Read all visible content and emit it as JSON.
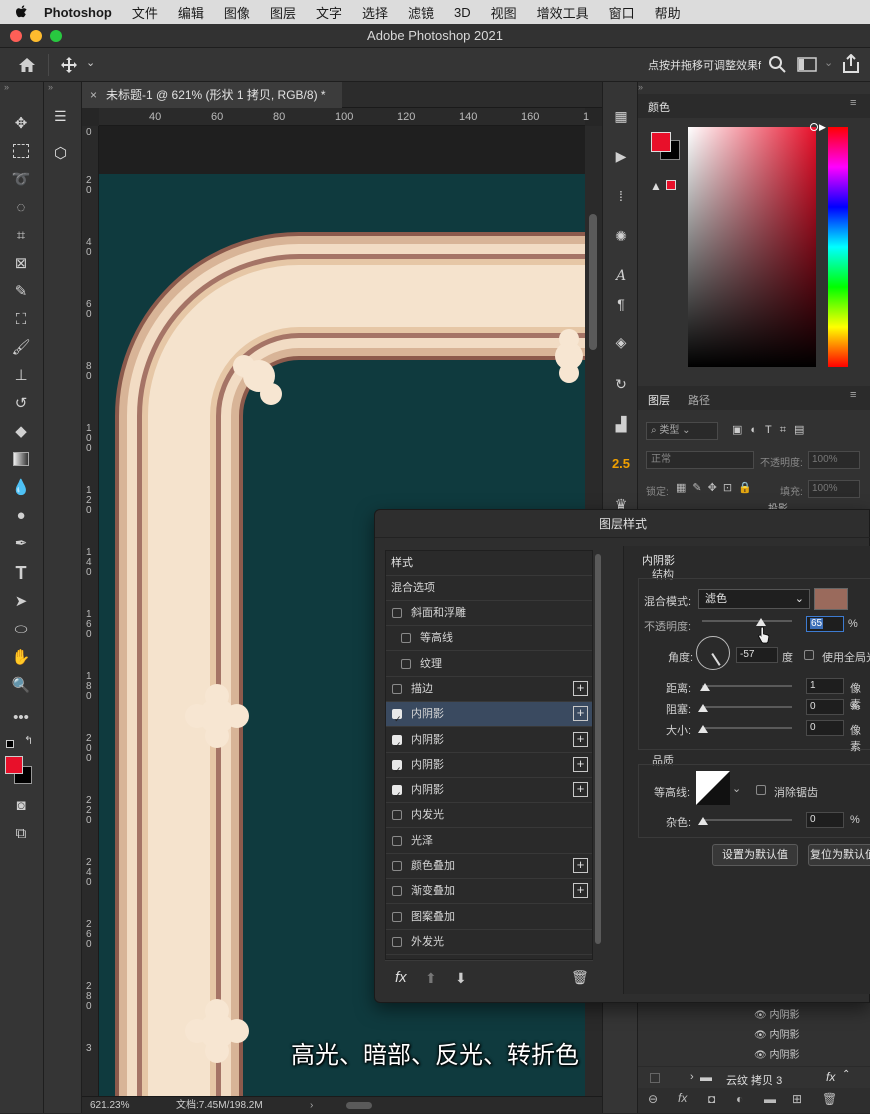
{
  "menubar": {
    "app": "Photoshop",
    "items": [
      "文件",
      "编辑",
      "图像",
      "图层",
      "文字",
      "选择",
      "滤镜",
      "3D",
      "视图",
      "增效工具",
      "窗口",
      "帮助"
    ]
  },
  "window": {
    "title": "Adobe Photoshop 2021"
  },
  "options": {
    "hint": "点按并拖移可调整效果f"
  },
  "document": {
    "tab_title": "未标题-1 @ 621% (形状 1 拷贝, RGB/8) *",
    "zoom": "621.23%",
    "doc_info": "文档:7.45M/198.2M"
  },
  "ruler": {
    "h_ticks": [
      "40",
      "60",
      "80",
      "100",
      "120",
      "140",
      "160",
      "1"
    ],
    "v_ticks": [
      "0",
      "2\n0",
      "4\n0",
      "6\n0",
      "8\n0",
      "1\n0\n0",
      "1\n2\n0",
      "1\n4\n0",
      "1\n6\n0",
      "1\n8\n0",
      "2\n0\n0",
      "2\n2\n0",
      "2\n4\n0",
      "2\n6\n0",
      "2\n8\n0",
      "3"
    ]
  },
  "colors": {
    "canvas_bg": "#0f3a3e",
    "frame_light": "#f2dcc4",
    "frame_mid": "#e6c7a6",
    "frame_dark": "#8c5a4c",
    "fg": "#e8102a",
    "shadow_color": "#9a6a5c"
  },
  "right_strip": {
    "badge": "2.5"
  },
  "color_panel": {
    "tab": "颜色"
  },
  "layers_panel": {
    "tab_layers": "图层",
    "tab_paths": "路径",
    "kind": "类型",
    "blend": "正常",
    "opacity_label": "不透明度:",
    "opacity": "100%",
    "lock_label": "锁定:",
    "fill_label": "填充:",
    "fill": "100%",
    "overflow_text": "投影",
    "effects": [
      "内阴影",
      "内阴影",
      "内阴影"
    ],
    "group": "云纹 拷贝 3"
  },
  "dialog": {
    "title": "图层样式",
    "styles_header": "样式",
    "blend_options": "混合选项",
    "items": [
      {
        "label": "斜面和浮雕",
        "checked": false,
        "plus": false,
        "indent": false
      },
      {
        "label": "等高线",
        "checked": false,
        "plus": false,
        "indent": true
      },
      {
        "label": "纹理",
        "checked": false,
        "plus": false,
        "indent": true
      },
      {
        "label": "描边",
        "checked": false,
        "plus": true,
        "indent": false
      },
      {
        "label": "内阴影",
        "checked": true,
        "plus": true,
        "indent": false,
        "selected": true
      },
      {
        "label": "内阴影",
        "checked": true,
        "plus": true,
        "indent": false
      },
      {
        "label": "内阴影",
        "checked": true,
        "plus": true,
        "indent": false
      },
      {
        "label": "内阴影",
        "checked": true,
        "plus": true,
        "indent": false
      },
      {
        "label": "内发光",
        "checked": false,
        "plus": false,
        "indent": false
      },
      {
        "label": "光泽",
        "checked": false,
        "plus": false,
        "indent": false
      },
      {
        "label": "颜色叠加",
        "checked": false,
        "plus": true,
        "indent": false
      },
      {
        "label": "渐变叠加",
        "checked": false,
        "plus": true,
        "indent": false
      },
      {
        "label": "图案叠加",
        "checked": false,
        "plus": false,
        "indent": false
      },
      {
        "label": "外发光",
        "checked": false,
        "plus": false,
        "indent": false
      }
    ],
    "section": "内阴影",
    "structure": "结构",
    "blend_mode_label": "混合模式:",
    "blend_mode": "滤色",
    "opacity_label": "不透明度:",
    "opacity": "65",
    "percent": "%",
    "angle_label": "角度:",
    "angle": "-57",
    "degree": "度",
    "global_light": "使用全局光",
    "distance_label": "距离:",
    "distance": "1",
    "px": "像素",
    "choke_label": "阻塞:",
    "choke": "0",
    "size_label": "大小:",
    "size": "0",
    "quality": "品质",
    "contour_label": "等高线:",
    "antialias": "消除锯齿",
    "noise_label": "杂色:",
    "noise": "0",
    "set_default": "设置为默认值",
    "reset_default": "复位为默认值",
    "fx": "fx"
  },
  "caption": "高光、暗部、反光、转折色"
}
